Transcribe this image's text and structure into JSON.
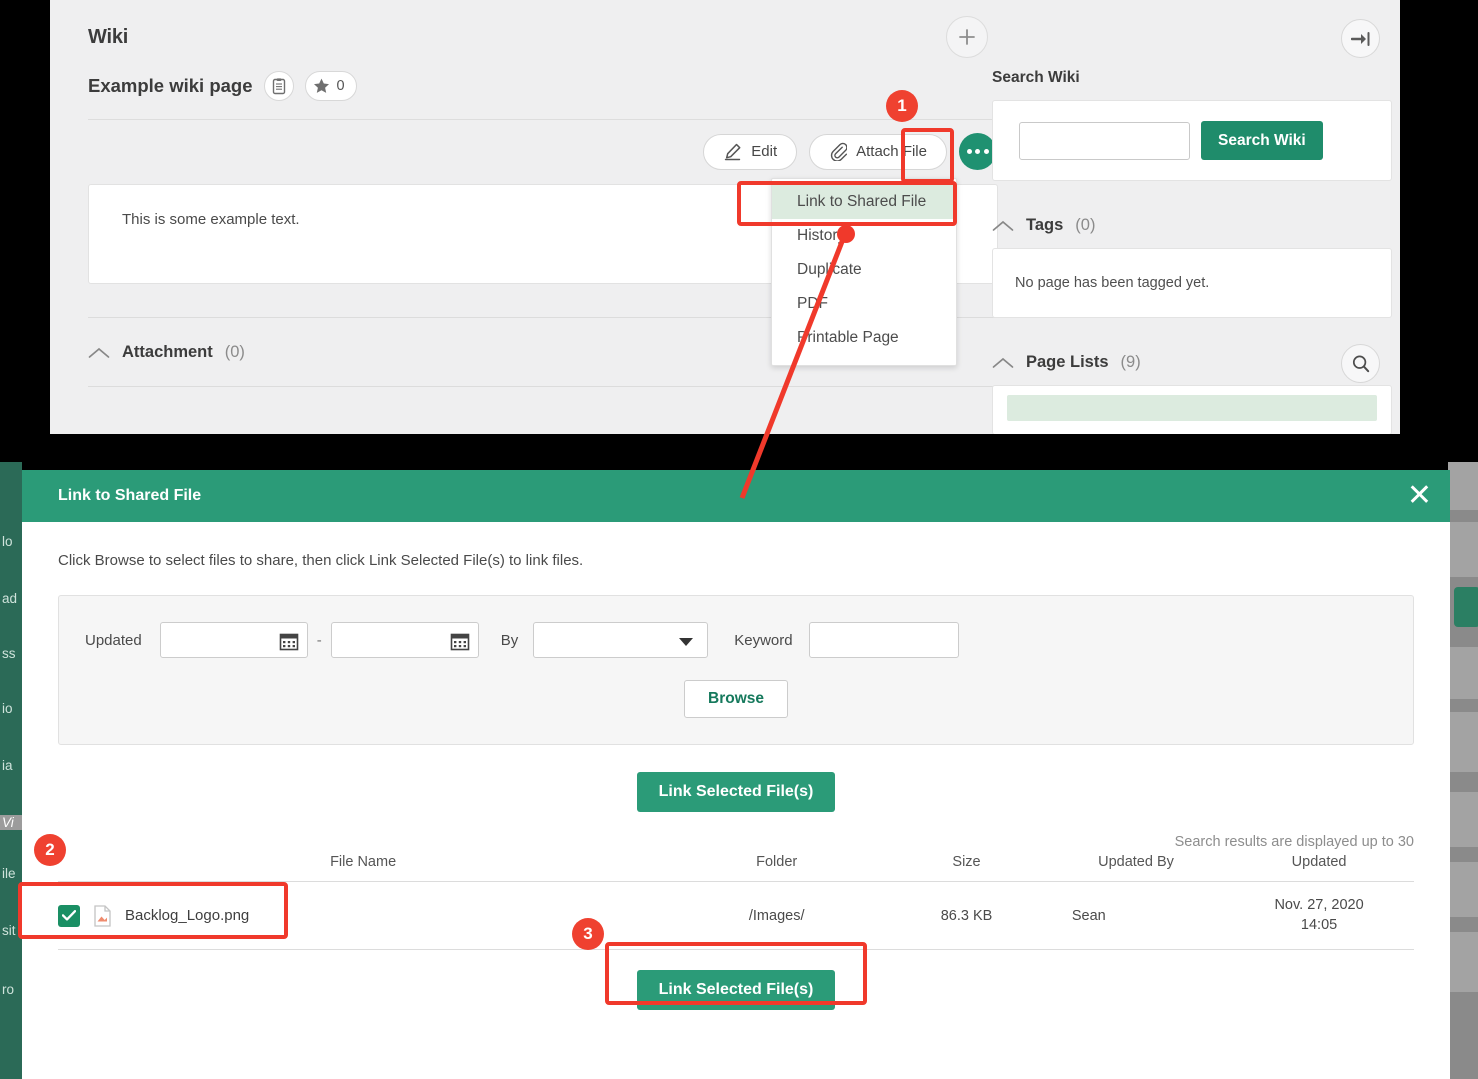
{
  "wiki": {
    "title": "Wiki",
    "page_title": "Example wiki page",
    "star_count": "0",
    "add_icon": "plus-icon",
    "notes_icon": "notes-icon",
    "star_icon": "star-icon",
    "collapse_icon": "collapse-panel-icon",
    "actions": {
      "edit_label": "Edit",
      "edit_icon": "pencil-icon",
      "attach_label": "Attach File",
      "attach_icon": "paperclip-icon",
      "more_icon": "ellipsis-icon"
    },
    "dropdown": {
      "items": [
        {
          "label": "Link to Shared File",
          "selected": true
        },
        {
          "label": "History",
          "selected": false
        },
        {
          "label": "Duplicate",
          "selected": false
        },
        {
          "label": "PDF",
          "selected": false
        },
        {
          "label": "Printable Page",
          "selected": false
        }
      ]
    },
    "content_text": "This is some example text.",
    "attachment": {
      "label": "Attachment",
      "count": "(0)"
    }
  },
  "sidebar": {
    "search_heading": "Search Wiki",
    "search_value": "",
    "search_button": "Search Wiki",
    "tags": {
      "label": "Tags",
      "count": "(0)",
      "empty_message": "No page has been tagged yet."
    },
    "page_lists": {
      "label": "Page Lists",
      "count": "(9)",
      "search_icon": "magnifier-icon"
    }
  },
  "backdrop": {
    "left_items": [
      "lo",
      "ad",
      "ss",
      "io",
      "ia",
      "Vi",
      "ile",
      "sit",
      "ro"
    ]
  },
  "modal": {
    "title": "Link to Shared File",
    "close_icon": "close-icon",
    "description": "Click Browse to select files to share, then click Link Selected File(s) to link files.",
    "filters": {
      "updated_label": "Updated",
      "date_from": "",
      "date_to": "",
      "date_separator": "-",
      "by_label": "By",
      "by_value": "",
      "keyword_label": "Keyword",
      "keyword_value": "",
      "calendar_icon": "calendar-icon",
      "dropdown_icon": "chevron-down-icon",
      "browse_label": "Browse"
    },
    "link_button_top": "Link Selected File(s)",
    "link_button_bottom": "Link Selected File(s)",
    "results_note": "Search results are displayed up to 30",
    "table": {
      "columns": [
        "File Name",
        "Folder",
        "Size",
        "Updated By",
        "Updated"
      ],
      "rows": [
        {
          "checked": true,
          "file_icon": "image-file-icon",
          "file_name": "Backlog_Logo.png",
          "folder": "/Images/",
          "size": "86.3 KB",
          "updated_by": "Sean",
          "updated": "Nov. 27, 2020 14:05"
        }
      ]
    }
  },
  "callouts": {
    "step1": "1",
    "step2": "2",
    "step3": "3"
  },
  "colors": {
    "accent_green": "#2b9b78",
    "dark_green": "#1f8c6b",
    "callout_red": "#f0392b",
    "panel_bg": "#efeff0",
    "highlight_green": "#dcebdf"
  }
}
